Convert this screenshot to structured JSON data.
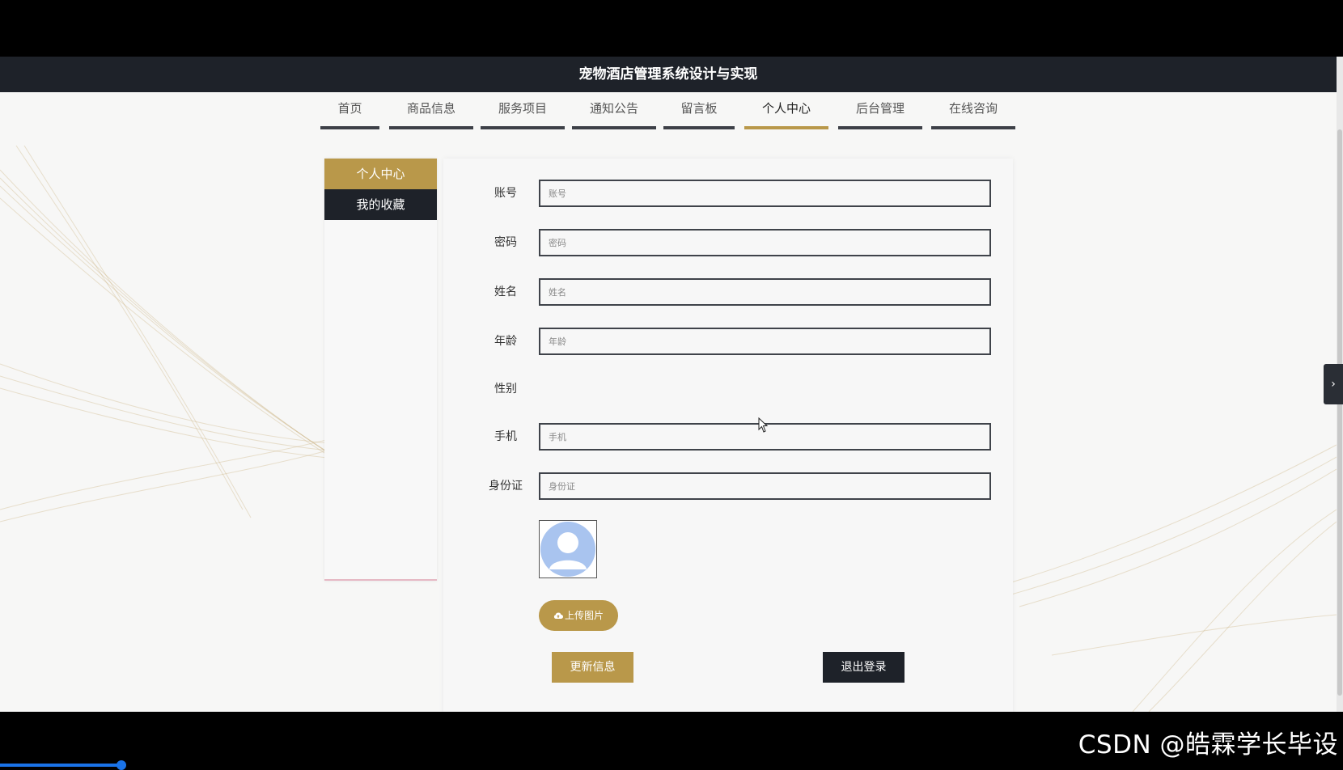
{
  "app_title": "宠物酒店管理系统设计与实现",
  "nav": {
    "items": [
      {
        "label": "首页"
      },
      {
        "label": "商品信息"
      },
      {
        "label": "服务项目"
      },
      {
        "label": "通知公告"
      },
      {
        "label": "留言板"
      },
      {
        "label": "个人中心",
        "active": true
      },
      {
        "label": "后台管理"
      },
      {
        "label": "在线咨询"
      }
    ]
  },
  "sidebar": {
    "items": [
      {
        "label": "个人中心",
        "active": true
      },
      {
        "label": "我的收藏"
      }
    ]
  },
  "form": {
    "account": {
      "label": "账号",
      "placeholder": "账号",
      "value": ""
    },
    "password": {
      "label": "密码",
      "placeholder": "密码",
      "value": ""
    },
    "name": {
      "label": "姓名",
      "placeholder": "姓名",
      "value": ""
    },
    "age": {
      "label": "年龄",
      "placeholder": "年龄",
      "value": ""
    },
    "gender": {
      "label": "性别"
    },
    "phone": {
      "label": "手机",
      "placeholder": "手机",
      "value": ""
    },
    "id_card": {
      "label": "身份证",
      "placeholder": "身份证",
      "value": ""
    }
  },
  "buttons": {
    "upload": "上传图片",
    "update": "更新信息",
    "logout": "退出登录"
  },
  "watermark": "CSDN @皓霖学长毕设",
  "colors": {
    "accent": "#b9984a",
    "dark": "#1e2229"
  }
}
